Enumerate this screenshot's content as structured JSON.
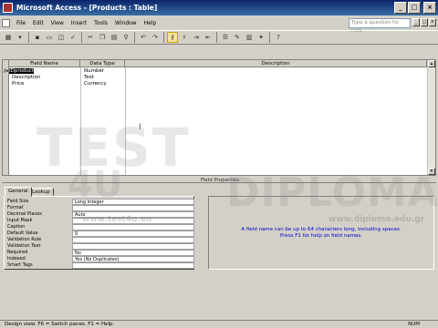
{
  "window": {
    "title": "Microsoft Access - [Products : Table]"
  },
  "menu": {
    "items": [
      "File",
      "Edit",
      "View",
      "Insert",
      "Tools",
      "Window",
      "Help"
    ],
    "help_placeholder": "Type a question for help"
  },
  "table": {
    "headers": [
      "Field Name",
      "Data Type",
      "Description"
    ],
    "rows": [
      {
        "field": "IDproduct",
        "type": "Number",
        "description": ""
      },
      {
        "field": "Description",
        "type": "Text",
        "description": ""
      },
      {
        "field": "Price",
        "type": "Currency",
        "description": ""
      }
    ]
  },
  "field_properties": {
    "label": "Field Properties",
    "tabs": [
      "General",
      "Lookup"
    ],
    "properties": [
      {
        "name": "Field Size",
        "value": "Long Integer"
      },
      {
        "name": "Format",
        "value": ""
      },
      {
        "name": "Decimal Places",
        "value": "Auto"
      },
      {
        "name": "Input Mask",
        "value": ""
      },
      {
        "name": "Caption",
        "value": ""
      },
      {
        "name": "Default Value",
        "value": "0"
      },
      {
        "name": "Validation Rule",
        "value": ""
      },
      {
        "name": "Validation Text",
        "value": ""
      },
      {
        "name": "Required",
        "value": "No"
      },
      {
        "name": "Indexed",
        "value": "Yes (No Duplicates)"
      },
      {
        "name": "Smart Tags",
        "value": ""
      }
    ],
    "hint": "A field name can be up to 64 characters long, including spaces. Press F1 for help on field names."
  },
  "watermark": {
    "big1": "TEST",
    "big2": "4U",
    "big3": "DIPLOMA",
    "site1": "www.test4u.eu",
    "site2": "www.diploma.edu.gr"
  },
  "status": {
    "left": "Design view.  F6 = Switch panes.  F1 = Help.",
    "right": "NUM"
  }
}
